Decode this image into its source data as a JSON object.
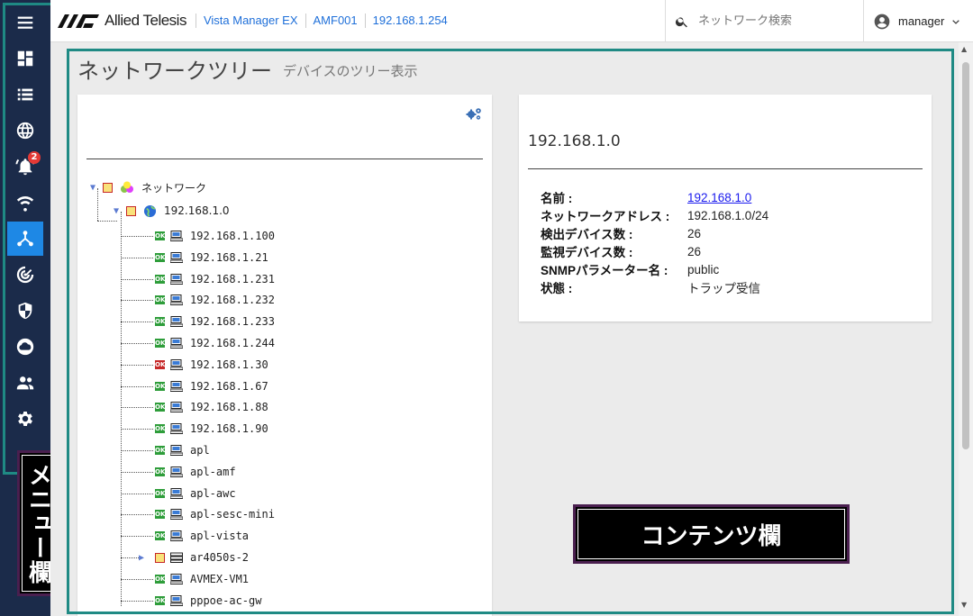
{
  "sidebar": {
    "items": [
      {
        "icon": "menu-icon"
      },
      {
        "icon": "dashboard-icon"
      },
      {
        "icon": "list-icon"
      },
      {
        "icon": "globe-icon"
      },
      {
        "icon": "alarm-icon",
        "badge": "2"
      },
      {
        "icon": "wifi-icon"
      },
      {
        "icon": "network-tree-icon",
        "active": true
      },
      {
        "icon": "radar-icon"
      },
      {
        "icon": "shield-icon"
      },
      {
        "icon": "cloud-icon"
      },
      {
        "icon": "users-icon"
      },
      {
        "icon": "settings-icon"
      }
    ],
    "annotation": "メニュー欄"
  },
  "topbar": {
    "brand": "Allied Telesis",
    "breadcrumbs": [
      "Vista Manager EX",
      "AMF001",
      "192.168.1.254"
    ],
    "search_placeholder": "ネットワーク検索",
    "user": "manager"
  },
  "page": {
    "title": "ネットワークツリー",
    "subtitle": "デバイスのツリー表示"
  },
  "tree": {
    "root": "ネットワーク",
    "subnet": "192.168.1.0",
    "nodes": [
      {
        "label": "192.168.1.100",
        "status": "OK"
      },
      {
        "label": "192.168.1.21",
        "status": "OK"
      },
      {
        "label": "192.168.1.231",
        "status": "OK"
      },
      {
        "label": "192.168.1.232",
        "status": "OK"
      },
      {
        "label": "192.168.1.233",
        "status": "OK"
      },
      {
        "label": "192.168.1.244",
        "status": "OK"
      },
      {
        "label": "192.168.1.30",
        "status": "ERR"
      },
      {
        "label": "192.168.1.67",
        "status": "OK"
      },
      {
        "label": "192.168.1.88",
        "status": "OK"
      },
      {
        "label": "192.168.1.90",
        "status": "OK"
      },
      {
        "label": "apl",
        "status": "OK"
      },
      {
        "label": "apl-amf",
        "status": "OK"
      },
      {
        "label": "apl-awc",
        "status": "OK"
      },
      {
        "label": "apl-sesc-mini",
        "status": "OK"
      },
      {
        "label": "apl-vista",
        "status": "OK"
      },
      {
        "label": "ar4050s-2",
        "status": "WARN",
        "expandable": true
      },
      {
        "label": "AVMEX-VM1",
        "status": "OK"
      },
      {
        "label": "pppoe-ac-gw",
        "status": "OK"
      }
    ]
  },
  "detail": {
    "title": "192.168.1.0",
    "props": [
      {
        "key": "名前 :",
        "value": "192.168.1.0",
        "link": true
      },
      {
        "key": "ネットワークアドレス :",
        "value": "192.168.1.0/24"
      },
      {
        "key": "検出デバイス数 :",
        "value": "26"
      },
      {
        "key": "監視デバイス数 :",
        "value": "26"
      },
      {
        "key": "SNMPパラメーター名 :",
        "value": "public"
      },
      {
        "key": "状態 :",
        "value": "トラップ受信"
      }
    ]
  },
  "content_annotation": "コンテンツ欄",
  "colors": {
    "sidebar": "#1b2b4a",
    "active": "#1e88e5",
    "frame": "#1f8a84",
    "ok": "#2e9d3a"
  }
}
